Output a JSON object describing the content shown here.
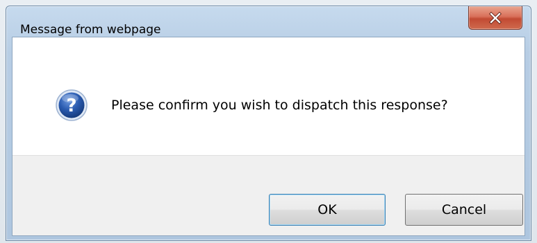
{
  "dialog": {
    "title": "Message from webpage",
    "close_icon": "close-icon",
    "message_icon": "question-icon",
    "message": "Please confirm you wish to dispatch this response?",
    "ok_label": "OK",
    "cancel_label": "Cancel"
  },
  "colors": {
    "titlebar": "#b7cde4",
    "close_button": "#c24a33",
    "client_background": "#ffffff",
    "button_area": "#f0f0f0",
    "default_button_border": "#3c7fb1",
    "question_icon": "#1d4f9a"
  }
}
